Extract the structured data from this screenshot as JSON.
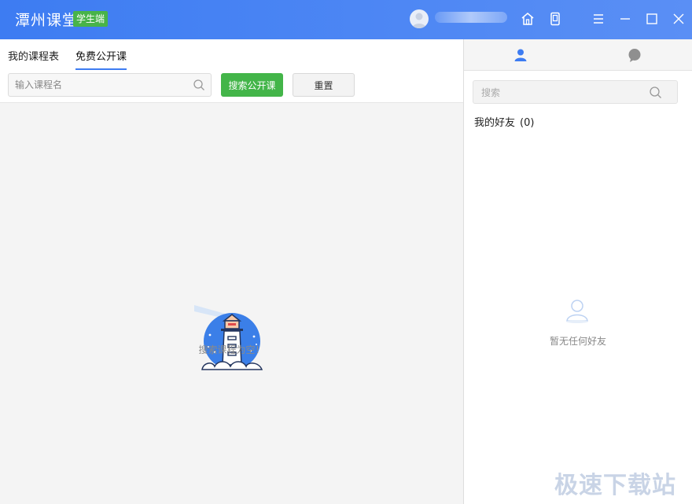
{
  "app": {
    "title": "潭州课堂",
    "badge": "学生端"
  },
  "titlebar_icons": [
    "user-avatar",
    "home-icon",
    "tablet-icon",
    "menu-icon",
    "minimize-icon",
    "maximize-icon",
    "close-icon"
  ],
  "left": {
    "tabs": [
      {
        "label": "我的课程表",
        "active": false
      },
      {
        "label": "免费公开课",
        "active": true
      }
    ],
    "search": {
      "placeholder": "输入课程名",
      "value": ""
    },
    "search_button": "搜索公开课",
    "reset_button": "重置",
    "empty_text": "搜索课程为空！"
  },
  "right": {
    "tabs": [
      "contacts-icon",
      "chat-icon"
    ],
    "search": {
      "placeholder": "搜索",
      "value": ""
    },
    "friends_label": "我的好友",
    "friends_count": "(0)",
    "empty_text": "暂无任何好友"
  },
  "watermark": "极速下载站",
  "colors": {
    "titlebar": "#3d7cf2",
    "badge": "#48b349",
    "primary_button": "#43b549",
    "tab_underline": "#3d7cf2"
  }
}
